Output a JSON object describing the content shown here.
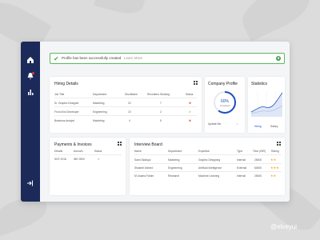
{
  "toast": {
    "message": "Profile has been successfully created",
    "link": "Learn More",
    "check_icon": "✔",
    "close_icon": "✖"
  },
  "sidebar": {
    "items": [
      {
        "icon": "home-icon",
        "glyph": "⌂"
      },
      {
        "icon": "bell-icon",
        "glyph": "🔔"
      },
      {
        "icon": "stats-icon",
        "glyph": "▮"
      }
    ],
    "logout_glyph": "⇥"
  },
  "hiring": {
    "title": "Hiring Details",
    "headers": [
      "Job Title",
      "Department",
      "Shortlisted",
      "Recruiters Working",
      "Status"
    ],
    "rows": [
      {
        "title": "Sr. Graphic Designer",
        "dept": "Marketing",
        "short": "22",
        "rec": "7",
        "status": "✖"
      },
      {
        "title": "Front-End Developer",
        "dept": "Engineering",
        "short": "10",
        "rec": "2",
        "status": "✔"
      },
      {
        "title": "Business Analyst",
        "dept": "Marketing",
        "short": "4",
        "rec": "5",
        "status": "✖"
      }
    ]
  },
  "profile": {
    "title": "Company Profile",
    "percent": "60%",
    "percent_value": 0.6,
    "sub": "Completed",
    "update": "Update Bio"
  },
  "stats": {
    "title": "Statistics",
    "legend": [
      "Hiring",
      "Salary"
    ],
    "accent": "#1f4fbf"
  },
  "payments": {
    "title": "Payments & Invoices",
    "headers": [
      "Details",
      "Amount",
      "Status"
    ],
    "rows": [
      {
        "details": "SDF 2018",
        "amount": "INR 2500",
        "status": "✔"
      }
    ]
  },
  "interview": {
    "title": "Interview Board",
    "headers": [
      "Name",
      "Department",
      "Expertise",
      "Type",
      "Time (INR)",
      "Rating"
    ],
    "rows": [
      {
        "name": "Saed Siddiqui",
        "dept": "Marketing",
        "exp": "Graphic Designing",
        "type": "Internal",
        "time": "25000",
        "rating": "★★"
      },
      {
        "name": "Shakeel Ahmed",
        "dept": "Engineering",
        "exp": "Artificial Intelligence",
        "type": "External",
        "time": "60000",
        "rating": "★★★"
      },
      {
        "name": "M Usama Fahim",
        "dept": "Research",
        "exp": "Machine Learning",
        "type": "Internal",
        "time": "25000",
        "rating": "★★"
      }
    ]
  },
  "watermark": "@elveyui"
}
